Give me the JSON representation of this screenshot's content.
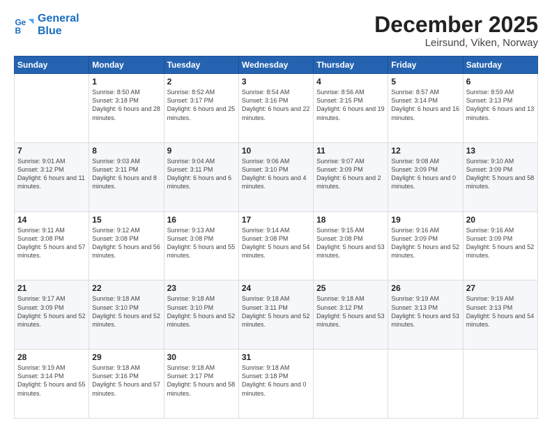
{
  "logo": {
    "line1": "General",
    "line2": "Blue"
  },
  "title": "December 2025",
  "subtitle": "Leirsund, Viken, Norway",
  "header_days": [
    "Sunday",
    "Monday",
    "Tuesday",
    "Wednesday",
    "Thursday",
    "Friday",
    "Saturday"
  ],
  "weeks": [
    [
      {
        "date": "",
        "sunrise": "",
        "sunset": "",
        "daylight": ""
      },
      {
        "date": "1",
        "sunrise": "8:50 AM",
        "sunset": "3:18 PM",
        "daylight": "6 hours and 28 minutes."
      },
      {
        "date": "2",
        "sunrise": "8:52 AM",
        "sunset": "3:17 PM",
        "daylight": "6 hours and 25 minutes."
      },
      {
        "date": "3",
        "sunrise": "8:54 AM",
        "sunset": "3:16 PM",
        "daylight": "6 hours and 22 minutes."
      },
      {
        "date": "4",
        "sunrise": "8:56 AM",
        "sunset": "3:15 PM",
        "daylight": "6 hours and 19 minutes."
      },
      {
        "date": "5",
        "sunrise": "8:57 AM",
        "sunset": "3:14 PM",
        "daylight": "6 hours and 16 minutes."
      },
      {
        "date": "6",
        "sunrise": "8:59 AM",
        "sunset": "3:13 PM",
        "daylight": "6 hours and 13 minutes."
      }
    ],
    [
      {
        "date": "7",
        "sunrise": "9:01 AM",
        "sunset": "3:12 PM",
        "daylight": "6 hours and 11 minutes."
      },
      {
        "date": "8",
        "sunrise": "9:03 AM",
        "sunset": "3:11 PM",
        "daylight": "6 hours and 8 minutes."
      },
      {
        "date": "9",
        "sunrise": "9:04 AM",
        "sunset": "3:11 PM",
        "daylight": "6 hours and 6 minutes."
      },
      {
        "date": "10",
        "sunrise": "9:06 AM",
        "sunset": "3:10 PM",
        "daylight": "6 hours and 4 minutes."
      },
      {
        "date": "11",
        "sunrise": "9:07 AM",
        "sunset": "3:09 PM",
        "daylight": "6 hours and 2 minutes."
      },
      {
        "date": "12",
        "sunrise": "9:08 AM",
        "sunset": "3:09 PM",
        "daylight": "6 hours and 0 minutes."
      },
      {
        "date": "13",
        "sunrise": "9:10 AM",
        "sunset": "3:09 PM",
        "daylight": "5 hours and 58 minutes."
      }
    ],
    [
      {
        "date": "14",
        "sunrise": "9:11 AM",
        "sunset": "3:08 PM",
        "daylight": "5 hours and 57 minutes."
      },
      {
        "date": "15",
        "sunrise": "9:12 AM",
        "sunset": "3:08 PM",
        "daylight": "5 hours and 56 minutes."
      },
      {
        "date": "16",
        "sunrise": "9:13 AM",
        "sunset": "3:08 PM",
        "daylight": "5 hours and 55 minutes."
      },
      {
        "date": "17",
        "sunrise": "9:14 AM",
        "sunset": "3:08 PM",
        "daylight": "5 hours and 54 minutes."
      },
      {
        "date": "18",
        "sunrise": "9:15 AM",
        "sunset": "3:08 PM",
        "daylight": "5 hours and 53 minutes."
      },
      {
        "date": "19",
        "sunrise": "9:16 AM",
        "sunset": "3:09 PM",
        "daylight": "5 hours and 52 minutes."
      },
      {
        "date": "20",
        "sunrise": "9:16 AM",
        "sunset": "3:09 PM",
        "daylight": "5 hours and 52 minutes."
      }
    ],
    [
      {
        "date": "21",
        "sunrise": "9:17 AM",
        "sunset": "3:09 PM",
        "daylight": "5 hours and 52 minutes."
      },
      {
        "date": "22",
        "sunrise": "9:18 AM",
        "sunset": "3:10 PM",
        "daylight": "5 hours and 52 minutes."
      },
      {
        "date": "23",
        "sunrise": "9:18 AM",
        "sunset": "3:10 PM",
        "daylight": "5 hours and 52 minutes."
      },
      {
        "date": "24",
        "sunrise": "9:18 AM",
        "sunset": "3:11 PM",
        "daylight": "5 hours and 52 minutes."
      },
      {
        "date": "25",
        "sunrise": "9:18 AM",
        "sunset": "3:12 PM",
        "daylight": "5 hours and 53 minutes."
      },
      {
        "date": "26",
        "sunrise": "9:19 AM",
        "sunset": "3:13 PM",
        "daylight": "5 hours and 53 minutes."
      },
      {
        "date": "27",
        "sunrise": "9:19 AM",
        "sunset": "3:13 PM",
        "daylight": "5 hours and 54 minutes."
      }
    ],
    [
      {
        "date": "28",
        "sunrise": "9:19 AM",
        "sunset": "3:14 PM",
        "daylight": "5 hours and 55 minutes."
      },
      {
        "date": "29",
        "sunrise": "9:18 AM",
        "sunset": "3:16 PM",
        "daylight": "5 hours and 57 minutes."
      },
      {
        "date": "30",
        "sunrise": "9:18 AM",
        "sunset": "3:17 PM",
        "daylight": "5 hours and 58 minutes."
      },
      {
        "date": "31",
        "sunrise": "9:18 AM",
        "sunset": "3:18 PM",
        "daylight": "6 hours and 0 minutes."
      },
      {
        "date": "",
        "sunrise": "",
        "sunset": "",
        "daylight": ""
      },
      {
        "date": "",
        "sunrise": "",
        "sunset": "",
        "daylight": ""
      },
      {
        "date": "",
        "sunrise": "",
        "sunset": "",
        "daylight": ""
      }
    ]
  ]
}
